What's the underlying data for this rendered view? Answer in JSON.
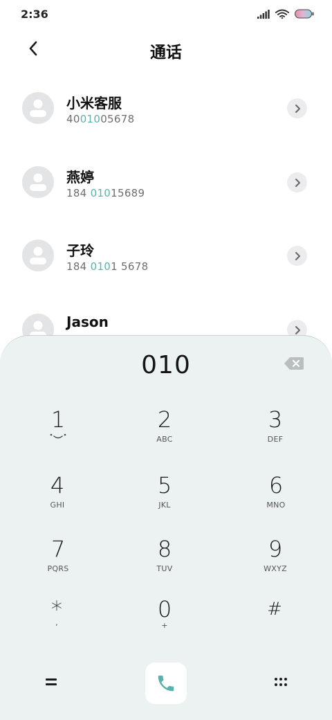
{
  "status_bar": {
    "time": "2:36",
    "icons": [
      "signal-icon",
      "wifi-icon",
      "battery-icon"
    ]
  },
  "header": {
    "title": "通话",
    "back_icon": "back-arrow-icon"
  },
  "contacts": [
    {
      "name": "小米客服",
      "number_parts": [
        "40",
        "010",
        "05678"
      ]
    },
    {
      "name": "燕婷",
      "number_parts": [
        "184 ",
        "010",
        "15689"
      ]
    },
    {
      "name": "子玲",
      "number_parts": [
        "184 ",
        "010",
        "1 5678"
      ]
    },
    {
      "name": "Jason",
      "number_parts": [
        "",
        "",
        ""
      ]
    }
  ],
  "dialpad": {
    "display": "010",
    "keys": [
      {
        "digit": "1",
        "letters": ""
      },
      {
        "digit": "2",
        "letters": "ABC"
      },
      {
        "digit": "3",
        "letters": "DEF"
      },
      {
        "digit": "4",
        "letters": "GHI"
      },
      {
        "digit": "5",
        "letters": "JKL"
      },
      {
        "digit": "6",
        "letters": "MNO"
      },
      {
        "digit": "7",
        "letters": "PQRS"
      },
      {
        "digit": "8",
        "letters": "TUV"
      },
      {
        "digit": "9",
        "letters": "WXYZ"
      },
      {
        "digit": "*",
        "letters": ","
      },
      {
        "digit": "0",
        "letters": "+"
      },
      {
        "digit": "#",
        "letters": ""
      }
    ],
    "bottom_icons": [
      "equals-icon",
      "phone-icon",
      "keypad-grid-icon"
    ]
  },
  "colors": {
    "accent": "#5bb2ad",
    "dialpad_bg": "#ebf2f1",
    "avatar_bg": "#e3e4e6"
  }
}
